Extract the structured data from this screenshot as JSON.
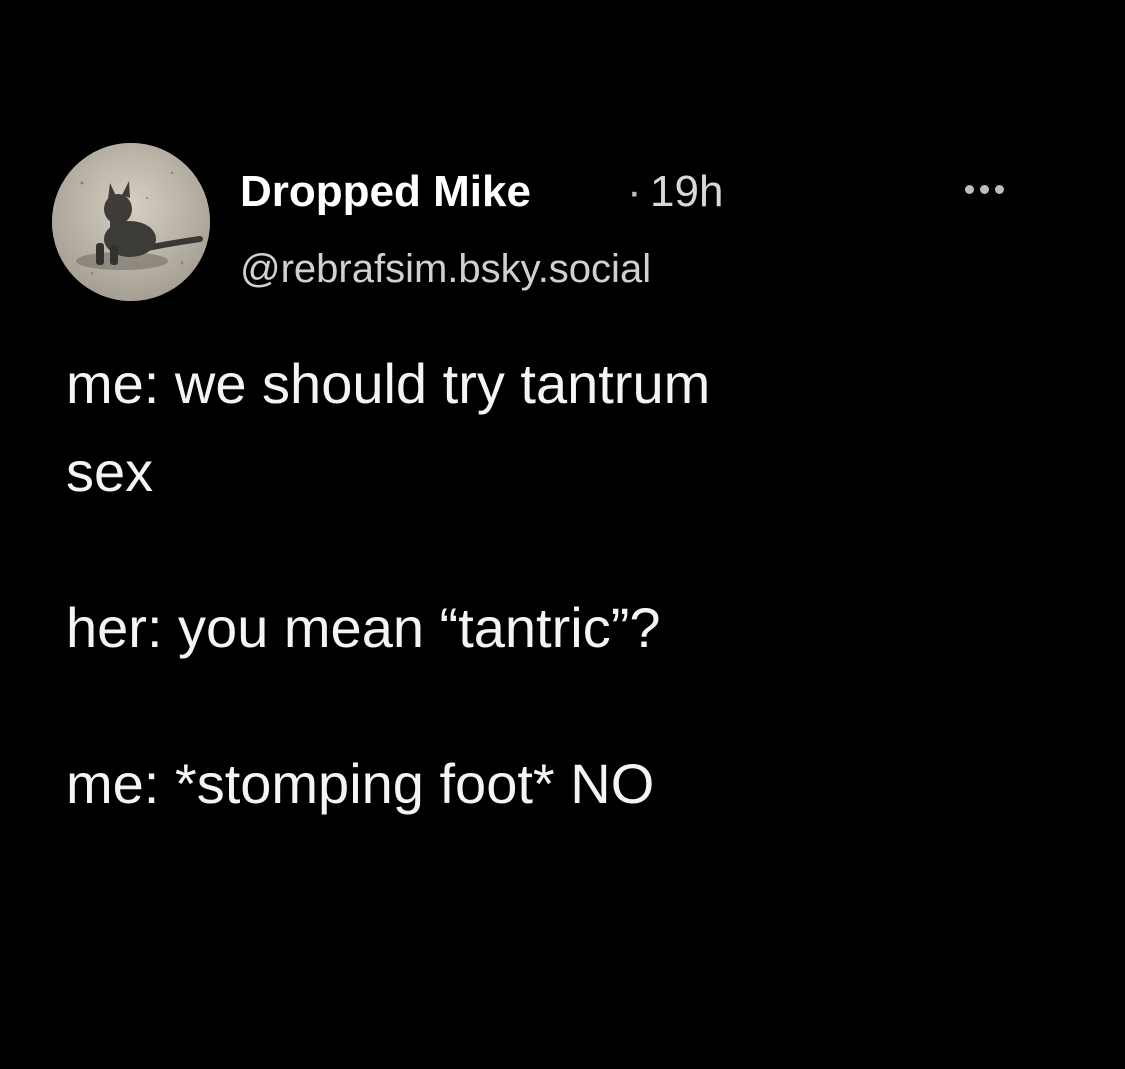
{
  "post": {
    "author": {
      "display_name": "Dropped Mike",
      "handle": "@rebrafsim.bsky.social",
      "avatar_icon": "cat-avatar-photo"
    },
    "separator": "·",
    "timestamp": "19h",
    "more_icon": "more-horizontal-icon",
    "body": {
      "line1": "me: we should try tantrum",
      "line2": "sex",
      "line3": "her: you mean “tantric”?",
      "line4": "me: *stomping foot* NO"
    }
  },
  "colors": {
    "background": "#000000",
    "text": "#f4f4f4",
    "muted": "#bdbdbd"
  }
}
